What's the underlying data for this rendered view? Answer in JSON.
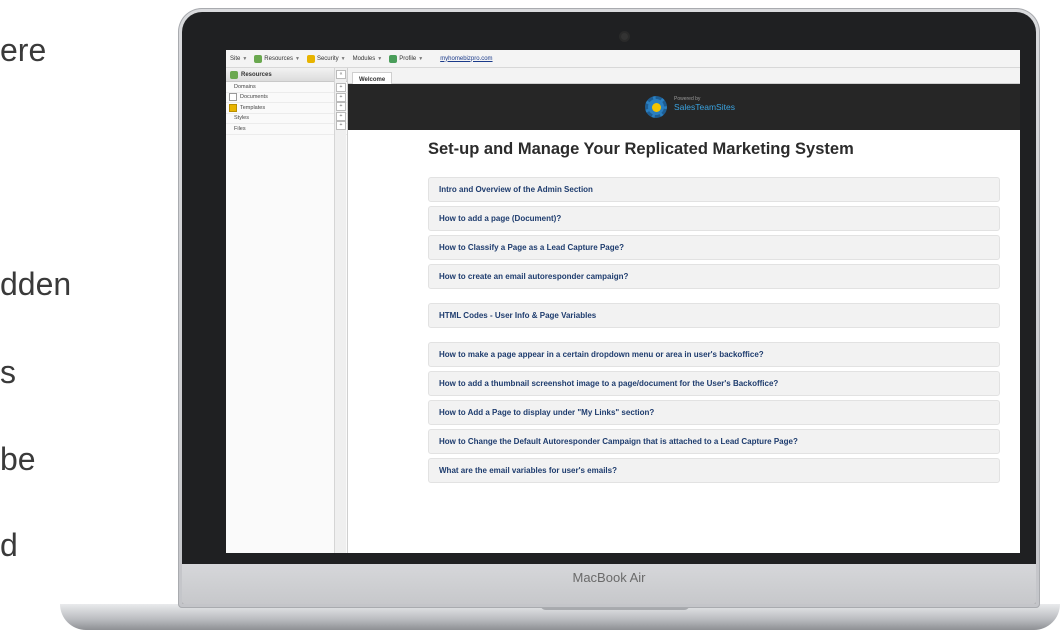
{
  "slide_fragments": [
    "ere",
    "dden",
    "s",
    "be",
    "d"
  ],
  "laptop": {
    "label": "MacBook Air"
  },
  "menu": {
    "items": [
      {
        "label": "Site",
        "icon": "none"
      },
      {
        "label": "Resources",
        "icon": "resources-icon"
      },
      {
        "label": "Security",
        "icon": "lock-icon"
      },
      {
        "label": "Modules",
        "icon": "none"
      },
      {
        "label": "Profile",
        "icon": "user-icon"
      }
    ],
    "link": "myhomebizpro.com"
  },
  "sidebar": {
    "header": "Resources",
    "items": [
      "Domains",
      "Documents",
      "Templates",
      "Styles",
      "Files"
    ]
  },
  "tab": {
    "label": "Welcome"
  },
  "banner": {
    "powered": "Powered by",
    "brand": "SalesTeamSites"
  },
  "main": {
    "heading": "Set-up and Manage Your Replicated Marketing System",
    "groups": [
      [
        "Intro and Overview of the Admin Section",
        "How to add a page (Document)?",
        "How to Classify a Page as a Lead Capture Page?",
        "How to create an email autoresponder campaign?"
      ],
      [
        "HTML Codes - User Info & Page Variables"
      ],
      [
        "How to make a page appear in a certain dropdown menu or area in user's backoffice?",
        "How to add a thumbnail screenshot image to a page/document for the User's Backoffice?",
        "How to Add a Page to display under \"My Links\" section?",
        "How to Change the Default Autoresponder Campaign that is attached to a Lead Capture Page?",
        "What are the email variables for user's emails?"
      ]
    ]
  },
  "colors": {
    "accent": "#1e3c6e",
    "banner": "#262626",
    "brand": "#3aa3e0"
  }
}
